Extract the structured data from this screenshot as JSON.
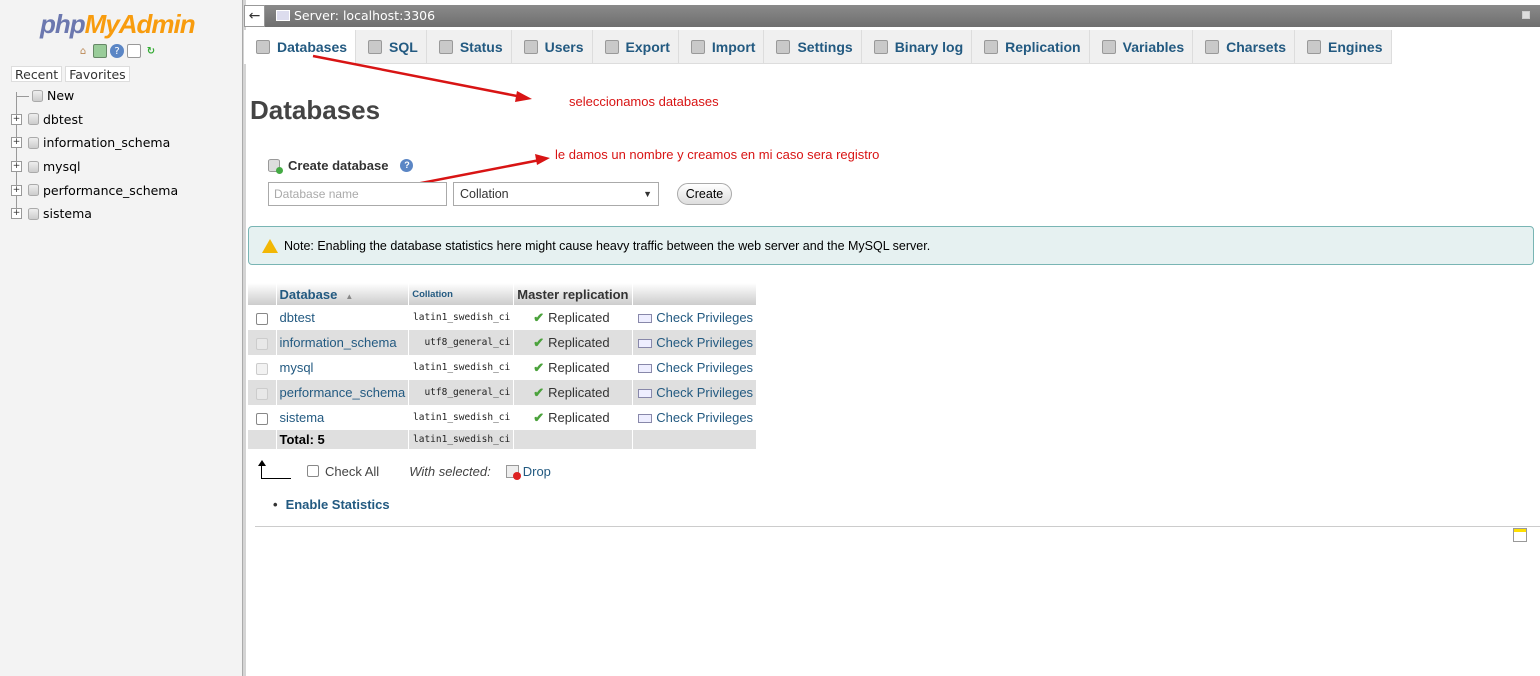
{
  "nav": {
    "logo_php": "php",
    "logo_myadmin": "MyAdmin",
    "icons": [
      "home-icon",
      "exit-icon",
      "help-icon",
      "docs-icon",
      "reload-icon"
    ],
    "recent_label": "Recent",
    "favorites_label": "Favorites",
    "tree": [
      "New",
      "dbtest",
      "information_schema",
      "mysql",
      "performance_schema",
      "sistema"
    ]
  },
  "topbar": {
    "back_symbol": "←",
    "server_label": "Server: localhost:3306"
  },
  "tabs": [
    {
      "label": "Databases",
      "icon": "database-icon",
      "active": true
    },
    {
      "label": "SQL",
      "icon": "sql-icon"
    },
    {
      "label": "Status",
      "icon": "status-icon"
    },
    {
      "label": "Users",
      "icon": "users-icon"
    },
    {
      "label": "Export",
      "icon": "export-icon"
    },
    {
      "label": "Import",
      "icon": "import-icon"
    },
    {
      "label": "Settings",
      "icon": "wrench-icon"
    },
    {
      "label": "Binary log",
      "icon": "binlog-icon"
    },
    {
      "label": "Replication",
      "icon": "replication-icon"
    },
    {
      "label": "Variables",
      "icon": "variables-icon"
    },
    {
      "label": "Charsets",
      "icon": "charsets-icon"
    },
    {
      "label": "Engines",
      "icon": "engines-icon"
    }
  ],
  "main": {
    "title": "Databases",
    "annotation_1": "seleccionamos databases",
    "annotation_2": "le damos un nombre y creamos en mi caso sera registro",
    "create_heading": "Create database",
    "dbname_placeholder": "Database name",
    "collation_value": "Collation",
    "create_button": "Create",
    "notice": "Note: Enabling the database statistics here might cause heavy traffic between the web server and the MySQL server."
  },
  "table": {
    "headers": [
      "Database",
      "Collation",
      "Master replication"
    ],
    "rows": [
      {
        "name": "dbtest",
        "collation": "latin1_swedish_ci",
        "replication": "Replicated",
        "priv": "Check Privileges"
      },
      {
        "name": "information_schema",
        "collation": "utf8_general_ci",
        "replication": "Replicated",
        "priv": "Check Privileges"
      },
      {
        "name": "mysql",
        "collation": "latin1_swedish_ci",
        "replication": "Replicated",
        "priv": "Check Privileges"
      },
      {
        "name": "performance_schema",
        "collation": "utf8_general_ci",
        "replication": "Replicated",
        "priv": "Check Privileges"
      },
      {
        "name": "sistema",
        "collation": "latin1_swedish_ci",
        "replication": "Replicated",
        "priv": "Check Privileges"
      }
    ],
    "total_label": "Total: 5",
    "total_collation": "latin1_swedish_ci"
  },
  "footer": {
    "check_all": "Check All",
    "with_selected": "With selected:",
    "drop": "Drop",
    "enable_stats": "Enable Statistics"
  },
  "colors": {
    "link": "#235a81",
    "annotation": "#d81414",
    "logo_php": "#6c78af",
    "logo_myadmin": "#f89c0e"
  }
}
